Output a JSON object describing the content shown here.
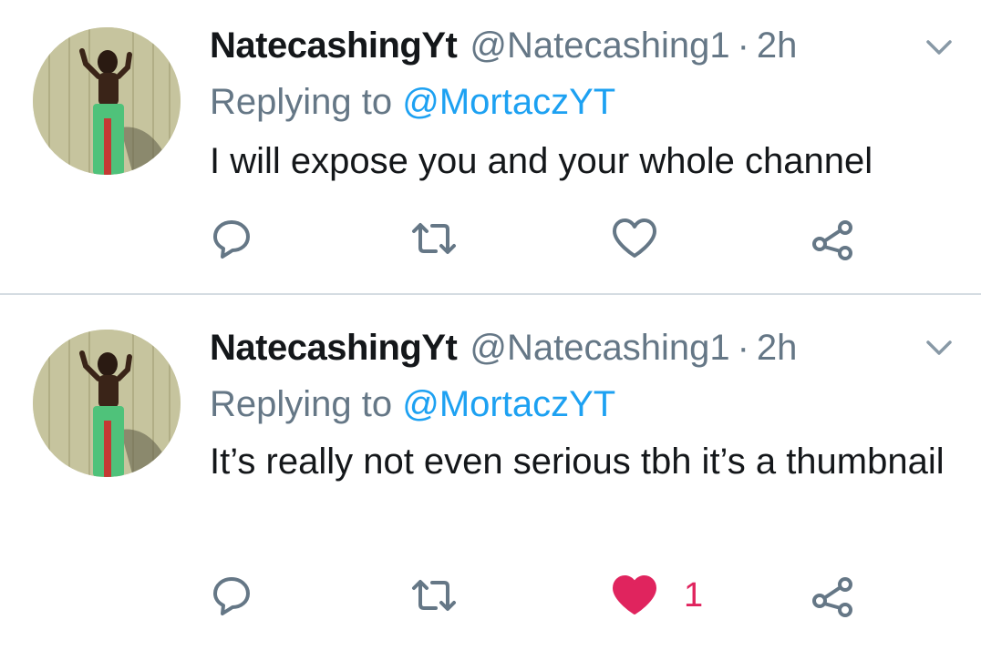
{
  "tweets": [
    {
      "display_name": "NatecashingYt",
      "handle": "@Natecashing1",
      "separator": "·",
      "time": "2h",
      "replying_prefix": "Replying to",
      "replying_to": "@MortaczYT",
      "text": "I will expose you and your whole channel",
      "liked": false,
      "like_count": ""
    },
    {
      "display_name": "NatecashingYt",
      "handle": "@Natecashing1",
      "separator": "·",
      "time": "2h",
      "replying_prefix": "Replying to",
      "replying_to": "@MortaczYT",
      "text": "It’s really not even serious tbh it’s a thumbnail",
      "liked": true,
      "like_count": "1"
    }
  ],
  "colors": {
    "secondary_text": "#657786",
    "mention": "#1da1f2",
    "like_active": "#e0245e",
    "divider": "#d5dce2"
  },
  "icons": {
    "reply": "speech-bubble-icon",
    "retweet": "retweet-arrows-icon",
    "like": "heart-icon",
    "share": "share-nodes-icon",
    "menu": "chevron-down-icon"
  }
}
